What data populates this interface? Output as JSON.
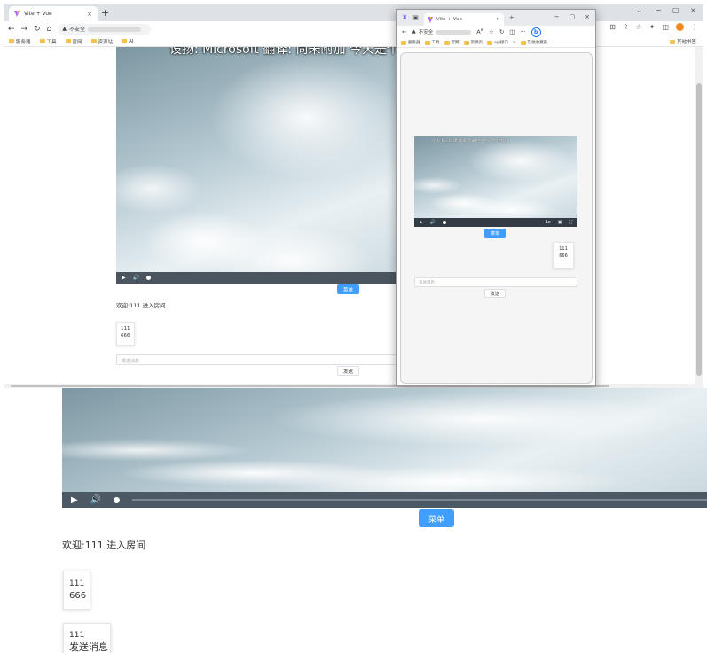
{
  "main_window": {
    "tab_title": "Vite + Vue",
    "tab_close": "×",
    "new_tab": "+",
    "minimize": "−",
    "restore": "▢",
    "close": "×",
    "collapse": "⌄",
    "address_prefix": "不安全",
    "bookmarks": [
      "服务器",
      "工具",
      "官网",
      "资源站",
      "AI"
    ],
    "other_bookmarks": "其他书签"
  },
  "popup_window": {
    "tab_title": "Vite + Vue",
    "tab_close": "×",
    "new_tab": "+",
    "minimize": "−",
    "restore": "▢",
    "close": "×",
    "address_prefix": "不安全",
    "bookmarks": [
      "服务器",
      "工具",
      "官网",
      "资源页",
      "api接口"
    ],
    "more_bookmarks": ">",
    "other_bookmarks": "其他收藏夹",
    "more_menu": "···",
    "video_speed": "1x",
    "menu_button": "菜单",
    "message_user": "111",
    "message_text": "666",
    "input_placeholder": "发送消息",
    "send_button": "发送"
  },
  "app": {
    "menu_button": "菜单",
    "welcome_text": "欢迎:111 进入房间",
    "message_user": "111",
    "message_text": "666",
    "input_placeholder": "发送消息",
    "send_button": "发送",
    "zoom_second_user": "111",
    "zoom_second_text": "发送消息"
  },
  "colors": {
    "primary": "#409eff",
    "player_bar": "#4a5560",
    "tabstrip": "#dee1e6"
  }
}
